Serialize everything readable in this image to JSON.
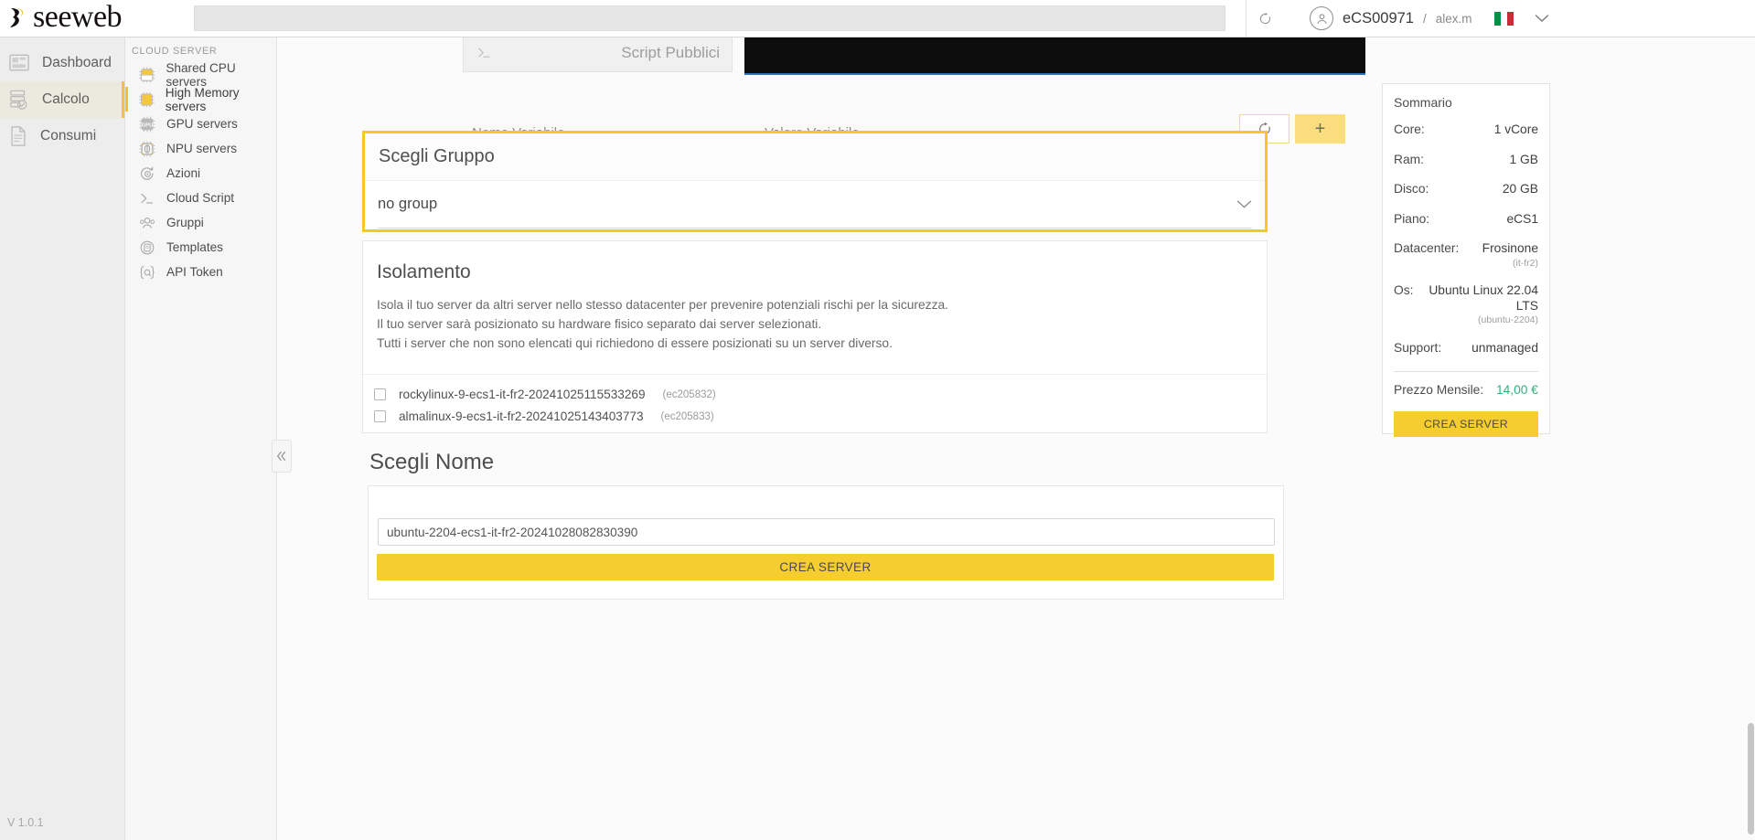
{
  "app": {
    "brand": "seeweb",
    "version": "V 1.0.1"
  },
  "header": {
    "search_placeholder": "",
    "search_value": "",
    "refresh_icon": "refresh-icon",
    "account": "eCS00971",
    "account_separator": "/",
    "username": "alex.m",
    "flag": "italy-flag",
    "caret": "chevron-down-icon"
  },
  "nav_primary": [
    {
      "label": "Dashboard",
      "icon": "dashboard-icon",
      "active": false
    },
    {
      "label": "Calcolo",
      "icon": "servers-icon",
      "active": true
    },
    {
      "label": "Consumi",
      "icon": "document-icon",
      "active": false
    }
  ],
  "nav_secondary": {
    "section_title": "CLOUD SERVER",
    "items": [
      {
        "label": "Shared CPU servers",
        "icon": "cpu-chip-icon",
        "active": false
      },
      {
        "label": "High Memory servers",
        "icon": "memory-chip-icon",
        "active": true
      },
      {
        "label": "GPU servers",
        "icon": "gpu-icon",
        "active": false
      },
      {
        "label": "NPU servers",
        "icon": "npu-icon",
        "active": false
      },
      {
        "label": "Azioni",
        "icon": "actions-gear-icon",
        "active": false
      },
      {
        "label": "Cloud Script",
        "icon": "terminal-icon",
        "active": false
      },
      {
        "label": "Gruppi",
        "icon": "users-group-icon",
        "active": false
      },
      {
        "label": "Templates",
        "icon": "templates-icon",
        "active": false
      },
      {
        "label": "API Token",
        "icon": "api-token-icon",
        "active": false
      }
    ]
  },
  "collapse_button": {
    "icon": "double-chevron-left-icon"
  },
  "main": {
    "script_card": {
      "tab_label": "Script Pubblici",
      "tab_icon": "terminal-icon",
      "editor_content": ""
    },
    "variables": {
      "name_placeholder": "Nome Variabile",
      "value_placeholder": "Valore Variabile",
      "refresh_icon": "refresh-icon",
      "add_label": "+"
    },
    "group_block": {
      "title": "Scegli Gruppo",
      "selected": "no group",
      "chevron": "chevron-down-icon",
      "highlight_color": "#f7c825"
    },
    "isolation": {
      "title": "Isolamento",
      "description_lines": [
        "Isola il tuo server da altri server nello stesso datacenter per prevenire potenziali rischi per la sicurezza.",
        "Il tuo server sarà posizionato su hardware fisico separato dai server selezionati.",
        "Tutti i server che non sono elencati qui richiedono di essere posizionati su un server diverso."
      ],
      "servers": [
        {
          "name": "rockylinux-9-ecs1-it-fr2-20241025115533269",
          "id": "(ec205832)",
          "checked": false
        },
        {
          "name": "almalinux-9-ecs1-it-fr2-20241025143403773",
          "id": "(ec205833)",
          "checked": false
        }
      ]
    },
    "name_block": {
      "title": "Scegli Nome",
      "input_value": "ubuntu-2204-ecs1-it-fr2-20241028082830390",
      "input_placeholder": "",
      "create_button": "CREA SERVER"
    }
  },
  "summary": {
    "title": "Sommario",
    "rows": [
      {
        "key": "Core:",
        "value": "1 vCore",
        "sub": ""
      },
      {
        "key": "Ram:",
        "value": "1 GB",
        "sub": ""
      },
      {
        "key": "Disco:",
        "value": "20 GB",
        "sub": ""
      },
      {
        "key": "Piano:",
        "value": "eCS1",
        "sub": ""
      },
      {
        "key": "Datacenter:",
        "value": "Frosinone",
        "sub": "(it-fr2)"
      },
      {
        "key": "Os:",
        "value": "Ubuntu Linux 22.04 LTS",
        "sub": "(ubuntu-2204)"
      },
      {
        "key": "Support:",
        "value": "unmanaged",
        "sub": ""
      }
    ],
    "price_label": "Prezzo Mensile:",
    "price_value": "14,00 €",
    "price_color": "#35b07a",
    "create_button": "CREA SERVER"
  }
}
